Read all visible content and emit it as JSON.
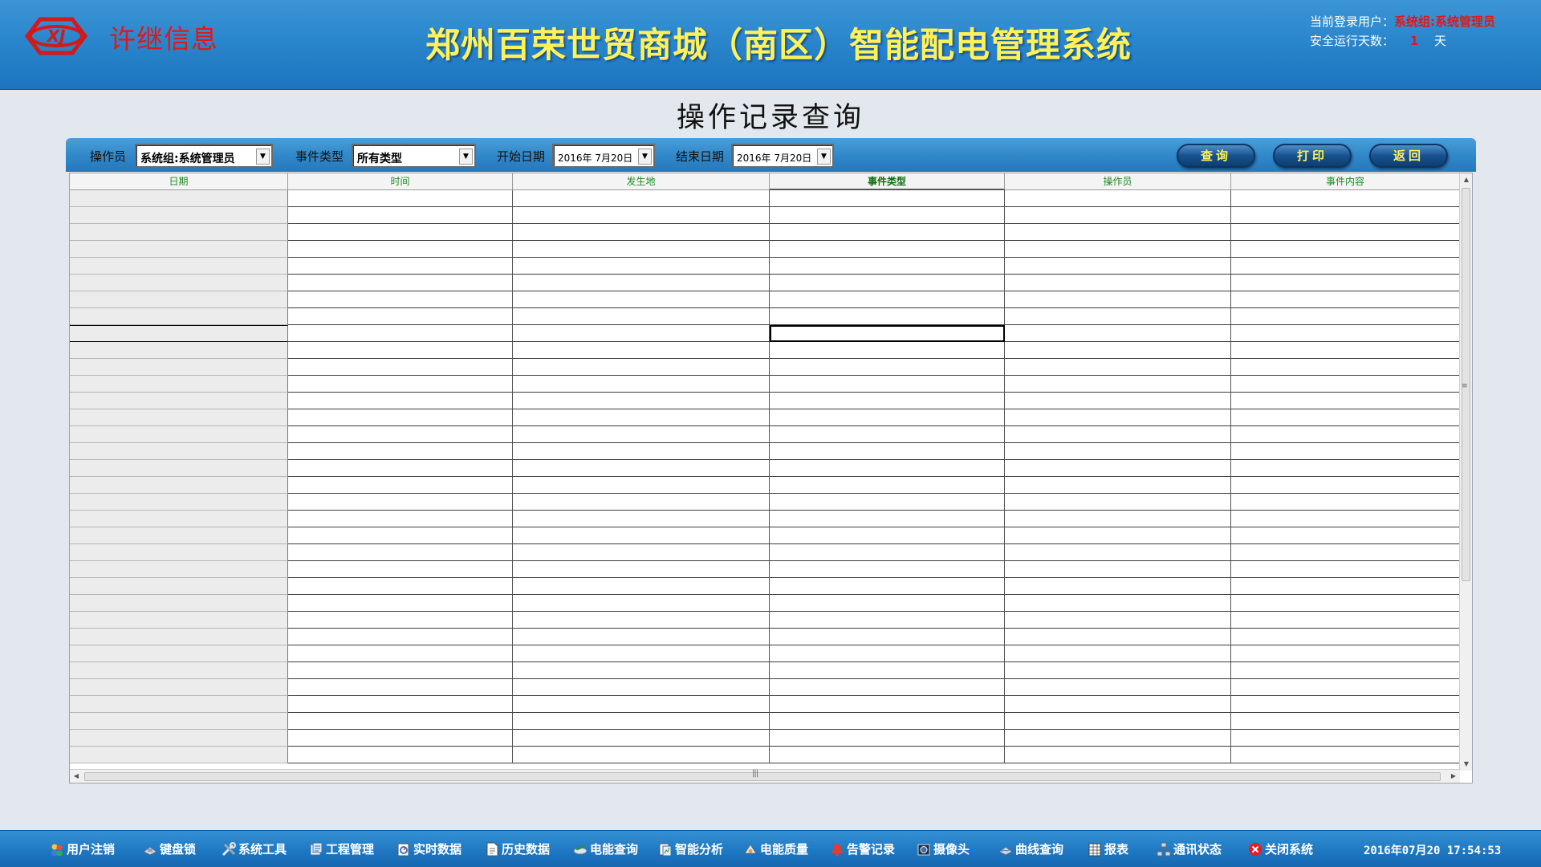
{
  "header": {
    "brand": "许继信息",
    "title": "郑州百荣世贸商城（南区）智能配电管理系统",
    "current_user_label": "当前登录用户：",
    "current_user_value": "系统组:系统管理员",
    "safe_days_label": "安全运行天数：",
    "safe_days_value": "1",
    "safe_days_unit": "天"
  },
  "page_title": "操作记录查询",
  "filters": {
    "operator_label": "操作员",
    "operator_value": "系统组:系统管理员",
    "event_type_label": "事件类型",
    "event_type_value": "所有类型",
    "start_date_label": "开始日期",
    "start_date_value": "2016年 7月20日",
    "end_date_label": "结束日期",
    "end_date_value": "2016年 7月20日"
  },
  "buttons": {
    "query": "查询",
    "print": "打印",
    "back": "返回"
  },
  "table": {
    "columns": [
      "日期",
      "时间",
      "发生地",
      "事件类型",
      "操作员",
      "事件内容"
    ],
    "rows": []
  },
  "taskbar": {
    "items": [
      {
        "label": "用户注销",
        "icon": "users-icon"
      },
      {
        "label": "键盘锁",
        "icon": "keyboard-lock-icon"
      },
      {
        "label": "系统工具",
        "icon": "tools-icon"
      },
      {
        "label": "工程管理",
        "icon": "project-icon"
      },
      {
        "label": "实时数据",
        "icon": "realtime-data-icon"
      },
      {
        "label": "历史数据",
        "icon": "history-data-icon"
      },
      {
        "label": "电能查询",
        "icon": "energy-query-icon"
      },
      {
        "label": "智能分析",
        "icon": "analysis-icon"
      },
      {
        "label": "电能质量",
        "icon": "power-quality-icon"
      },
      {
        "label": "告警记录",
        "icon": "alarm-icon"
      },
      {
        "label": "摄像头",
        "icon": "camera-icon"
      },
      {
        "label": "曲线查询",
        "icon": "curve-icon"
      },
      {
        "label": "报表",
        "icon": "report-icon"
      },
      {
        "label": "通讯状态",
        "icon": "network-icon"
      },
      {
        "label": "关闭系统",
        "icon": "close-icon"
      }
    ],
    "clock": "2016年07月20 17:54:53"
  },
  "colors": {
    "header_bg": "#2a86cc",
    "title_yellow": "#fff15a",
    "alert_red": "#e01818",
    "grid_header_text": "#1f8a1f"
  }
}
